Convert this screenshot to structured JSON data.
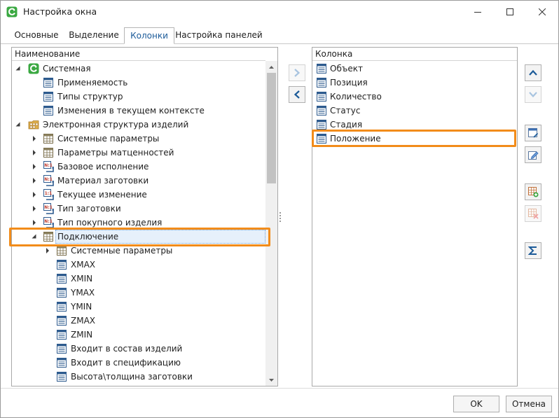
{
  "window": {
    "title": "Настройка окна"
  },
  "tabs": [
    {
      "label": "Основные"
    },
    {
      "label": "Выделение"
    },
    {
      "label": "Колонки"
    },
    {
      "label": "Настройка панелей"
    }
  ],
  "left_panel": {
    "header": "Наименование",
    "items": [
      {
        "label": "Системная",
        "expander": "open",
        "icon": "system-logo-icon"
      },
      {
        "label": "Применяемость",
        "icon": "document-list-icon"
      },
      {
        "label": "Типы структур",
        "icon": "document-list-icon"
      },
      {
        "label": "Изменения в текущем контексте",
        "icon": "document-list-icon"
      },
      {
        "label": "Электронная структура изделий",
        "expander": "open",
        "icon": "structure-folder-icon"
      },
      {
        "label": "Системные параметры",
        "expander": "closed",
        "icon": "table-grid-icon"
      },
      {
        "label": "Параметры матценностей",
        "expander": "closed",
        "icon": "table-grid-icon"
      },
      {
        "label": "Базовое исполнение",
        "expander": "closed",
        "icon": "n1-link-icon"
      },
      {
        "label": "Материал заготовки",
        "expander": "closed",
        "icon": "n1-link-icon"
      },
      {
        "label": "Текущее изменение",
        "expander": "closed",
        "icon": "one-one-link-icon"
      },
      {
        "label": "Тип заготовки",
        "expander": "closed",
        "icon": "n1-link-icon"
      },
      {
        "label": "Тип покупного изделия",
        "expander": "closed",
        "icon": "n1-link-icon"
      },
      {
        "label": "Подключение",
        "expander": "open",
        "icon": "table-grid-icon",
        "selected": true
      },
      {
        "label": "Системные параметры",
        "expander": "closed",
        "icon": "table-grid-icon"
      },
      {
        "label": "XMAX",
        "icon": "document-list-icon"
      },
      {
        "label": "XMIN",
        "icon": "document-list-icon"
      },
      {
        "label": "YMAX",
        "icon": "document-list-icon"
      },
      {
        "label": "YMIN",
        "icon": "document-list-icon"
      },
      {
        "label": "ZMAX",
        "icon": "document-list-icon"
      },
      {
        "label": "ZMIN",
        "icon": "document-list-icon"
      },
      {
        "label": "Входит в состав изделий",
        "icon": "document-list-icon"
      },
      {
        "label": "Входит в спецификацию",
        "icon": "document-list-icon"
      },
      {
        "label": "Высота\\толщина заготовки",
        "icon": "document-list-icon"
      }
    ]
  },
  "right_panel": {
    "header": "Колонка",
    "items": [
      {
        "label": "Объект",
        "icon": "document-list-icon"
      },
      {
        "label": "Позиция",
        "icon": "document-list-icon"
      },
      {
        "label": "Количество",
        "icon": "document-list-icon"
      },
      {
        "label": "Статус",
        "icon": "document-list-icon"
      },
      {
        "label": "Стадия",
        "icon": "document-list-icon"
      },
      {
        "label": "Положение",
        "icon": "document-list-icon"
      }
    ]
  },
  "move_buttons": {
    "add": "chevron-right-icon",
    "remove": "chevron-left-icon"
  },
  "side_buttons": [
    "arrow-up-icon",
    "arrow-down-icon",
    "edit-column-icon",
    "rename-icon",
    "add-table-icon",
    "delete-table-icon",
    "sum-icon"
  ],
  "footer": {
    "ok_label": "OK",
    "cancel_label": "Отмена"
  },
  "colors": {
    "accent": "#1c5b99",
    "highlight": "#f28c1a",
    "selection": "#e6f0fb"
  }
}
